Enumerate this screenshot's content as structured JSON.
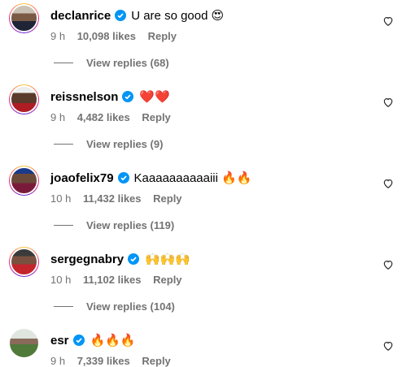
{
  "comments": [
    {
      "username": "declanrice",
      "verified": true,
      "text": "U are so good",
      "emoji": "😍",
      "time": "9 h",
      "likes": "10,098 likes",
      "reply": "Reply",
      "view_replies": "View replies (68)"
    },
    {
      "username": "reissnelson",
      "verified": true,
      "text": "",
      "emoji": "❤️❤️",
      "time": "9 h",
      "likes": "4,482 likes",
      "reply": "Reply",
      "view_replies": "View replies (9)"
    },
    {
      "username": "joaofelix79",
      "verified": true,
      "text": "Kaaaaaaaaaaiii",
      "emoji": "🔥🔥",
      "time": "10 h",
      "likes": "11,432 likes",
      "reply": "Reply",
      "view_replies": "View replies (119)"
    },
    {
      "username": "sergegnabry",
      "verified": true,
      "text": "",
      "emoji": "🙌🙌🙌",
      "time": "10 h",
      "likes": "11,102 likes",
      "reply": "Reply",
      "view_replies": "View replies (104)"
    },
    {
      "username": "esr",
      "verified": true,
      "text": "",
      "emoji": "🔥🔥🔥",
      "time": "9 h",
      "likes": "7,339 likes",
      "reply": "Reply",
      "view_replies": ""
    }
  ],
  "colors": {
    "verified": "#0095f6",
    "meta": "#737373",
    "story_ring": "#ee2a7b"
  },
  "icons": {
    "verified": "verified-badge-icon",
    "like": "heart-outline-icon"
  }
}
